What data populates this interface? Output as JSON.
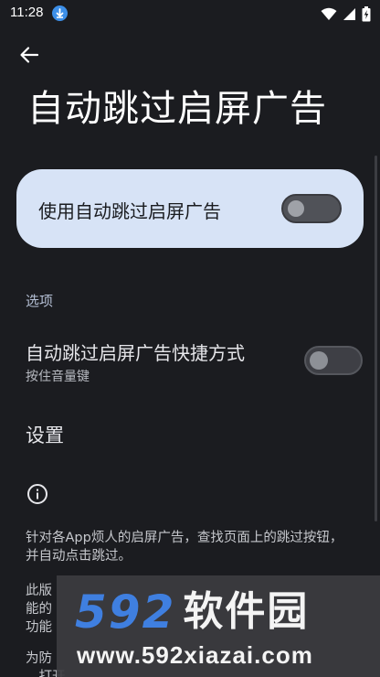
{
  "status_bar": {
    "time": "11:28",
    "download_icon": "download-icon",
    "wifi_icon": "wifi-icon",
    "signal_icon": "signal-icon",
    "battery_icon": "battery-charging-icon"
  },
  "header": {
    "back_icon": "arrow-back-icon",
    "title": "自动跳过启屏广告"
  },
  "main_toggle": {
    "label": "使用自动跳过启屏广告",
    "checked": false,
    "card_color": "#d7e3f6"
  },
  "options": {
    "section_title": "选项",
    "shortcut": {
      "title": "自动跳过启屏广告快捷方式",
      "summary": "按住音量键",
      "checked": false
    },
    "settings_label": "设置"
  },
  "info": {
    "icon": "info-icon",
    "text1": "针对各App烦人的启屏广告，查找页面上的跳过按钮，并自动点击跳过。",
    "text2": "此版\n能的\n功能",
    "text3": "为防\n　打开"
  },
  "watermark": {
    "number": "592",
    "brand": "软件园",
    "url": "www.592xiazai.com",
    "accent": "#3f7fe0"
  },
  "colors": {
    "background": "#1b1c20",
    "section_header": "#b4bfd4"
  }
}
